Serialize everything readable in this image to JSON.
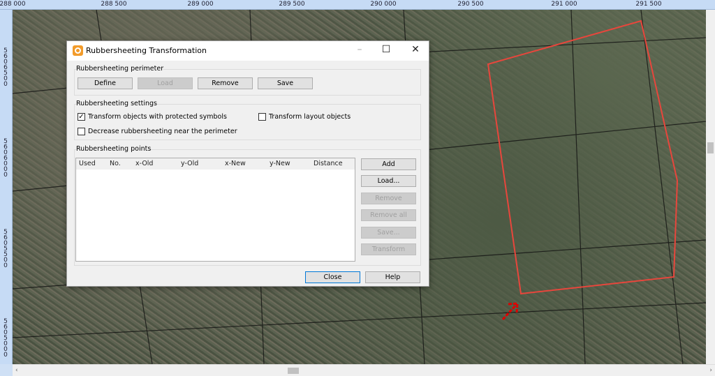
{
  "ruler": {
    "x_labels": [
      "288 000",
      "288 500",
      "289 000",
      "289 500",
      "290 000",
      "290 500",
      "291 000",
      "291 500"
    ],
    "y_labels": [
      "5606500",
      "5606000",
      "5605500",
      "5605000"
    ]
  },
  "dialog": {
    "title": "Rubbersheeting Transformation",
    "perimeter": {
      "label": "Rubbersheeting perimeter",
      "define": "Define",
      "load": "Load",
      "remove": "Remove",
      "save": "Save"
    },
    "settings": {
      "label": "Rubbersheeting settings",
      "transform_protected": {
        "label": "Transform objects with protected symbols",
        "checked": true
      },
      "transform_layout": {
        "label": "Transform layout objects",
        "checked": false
      },
      "decrease": {
        "label": "Decrease rubbersheeting near the perimeter",
        "checked": false
      }
    },
    "points": {
      "label": "Rubbersheeting points",
      "columns": [
        "Used",
        "No.",
        "x-Old",
        "y-Old",
        "x-New",
        "y-New",
        "Distance"
      ],
      "rows": [],
      "add": "Add",
      "load": "Load...",
      "remove": "Remove",
      "remove_all": "Remove all",
      "save": "Save...",
      "transform": "Transform"
    },
    "close": "Close",
    "help": "Help"
  },
  "colors": {
    "perimeter": "#e8463c",
    "annotation_arrows": "#e00000",
    "accent": "#0078d7"
  }
}
